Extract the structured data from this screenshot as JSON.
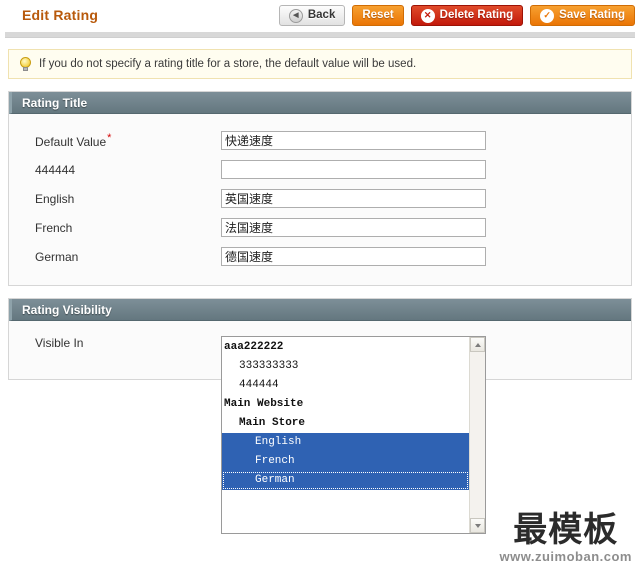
{
  "header": {
    "title": "Edit Rating",
    "buttons": [
      {
        "label": "Back",
        "icon": "back-arrow-icon",
        "style": "back"
      },
      {
        "label": "Reset",
        "icon": "",
        "style": "reset"
      },
      {
        "label": "Delete Rating",
        "icon": "delete-circle-icon",
        "style": "delete"
      },
      {
        "label": "Save Rating",
        "icon": "check-circle-icon",
        "style": "save"
      }
    ]
  },
  "notice": {
    "icon": "lightbulb-icon",
    "text": "If you do not specify a rating title for a store, the default value will be used."
  },
  "rating_title": {
    "section_label": "Rating Title",
    "fields": [
      {
        "label": "Default Value",
        "required": true,
        "value": "快递速度",
        "placeholder": ""
      },
      {
        "label": "444444",
        "required": false,
        "value": "",
        "placeholder": ""
      },
      {
        "label": "English",
        "required": false,
        "value": "英国速度",
        "placeholder": ""
      },
      {
        "label": "French",
        "required": false,
        "value": "法国速度",
        "placeholder": ""
      },
      {
        "label": "German",
        "required": false,
        "value": "德国速度",
        "placeholder": ""
      }
    ]
  },
  "rating_visibility": {
    "section_label": "Rating Visibility",
    "field_label": "Visible In",
    "options": [
      {
        "label": "aaa222222",
        "level": 0,
        "group": true,
        "selected": false,
        "focused": false
      },
      {
        "label": "333333333",
        "level": 1,
        "group": false,
        "selected": false,
        "focused": false
      },
      {
        "label": "444444",
        "level": 1,
        "group": false,
        "selected": false,
        "focused": false
      },
      {
        "label": "Main Website",
        "level": 0,
        "group": true,
        "selected": false,
        "focused": false
      },
      {
        "label": "Main Store",
        "level": 1,
        "group": true,
        "selected": false,
        "focused": false
      },
      {
        "label": "English",
        "level": 2,
        "group": false,
        "selected": true,
        "focused": false
      },
      {
        "label": "French",
        "level": 2,
        "group": false,
        "selected": true,
        "focused": false
      },
      {
        "label": "German",
        "level": 2,
        "group": false,
        "selected": true,
        "focused": true
      }
    ],
    "scrollbar": {
      "up_icon": "scroll-up-arrow-icon",
      "down_icon": "scroll-down-arrow-icon"
    }
  },
  "watermark": {
    "text": "最模板",
    "url": "www.zuimoban.com"
  },
  "colors": {
    "accent_orange": "#ea7505",
    "title_brown": "#b8590b",
    "danger_red": "#c2190b",
    "section_header": "#64777f",
    "selection_blue": "#2f62b3",
    "notice_bg": "#fffdf0"
  }
}
